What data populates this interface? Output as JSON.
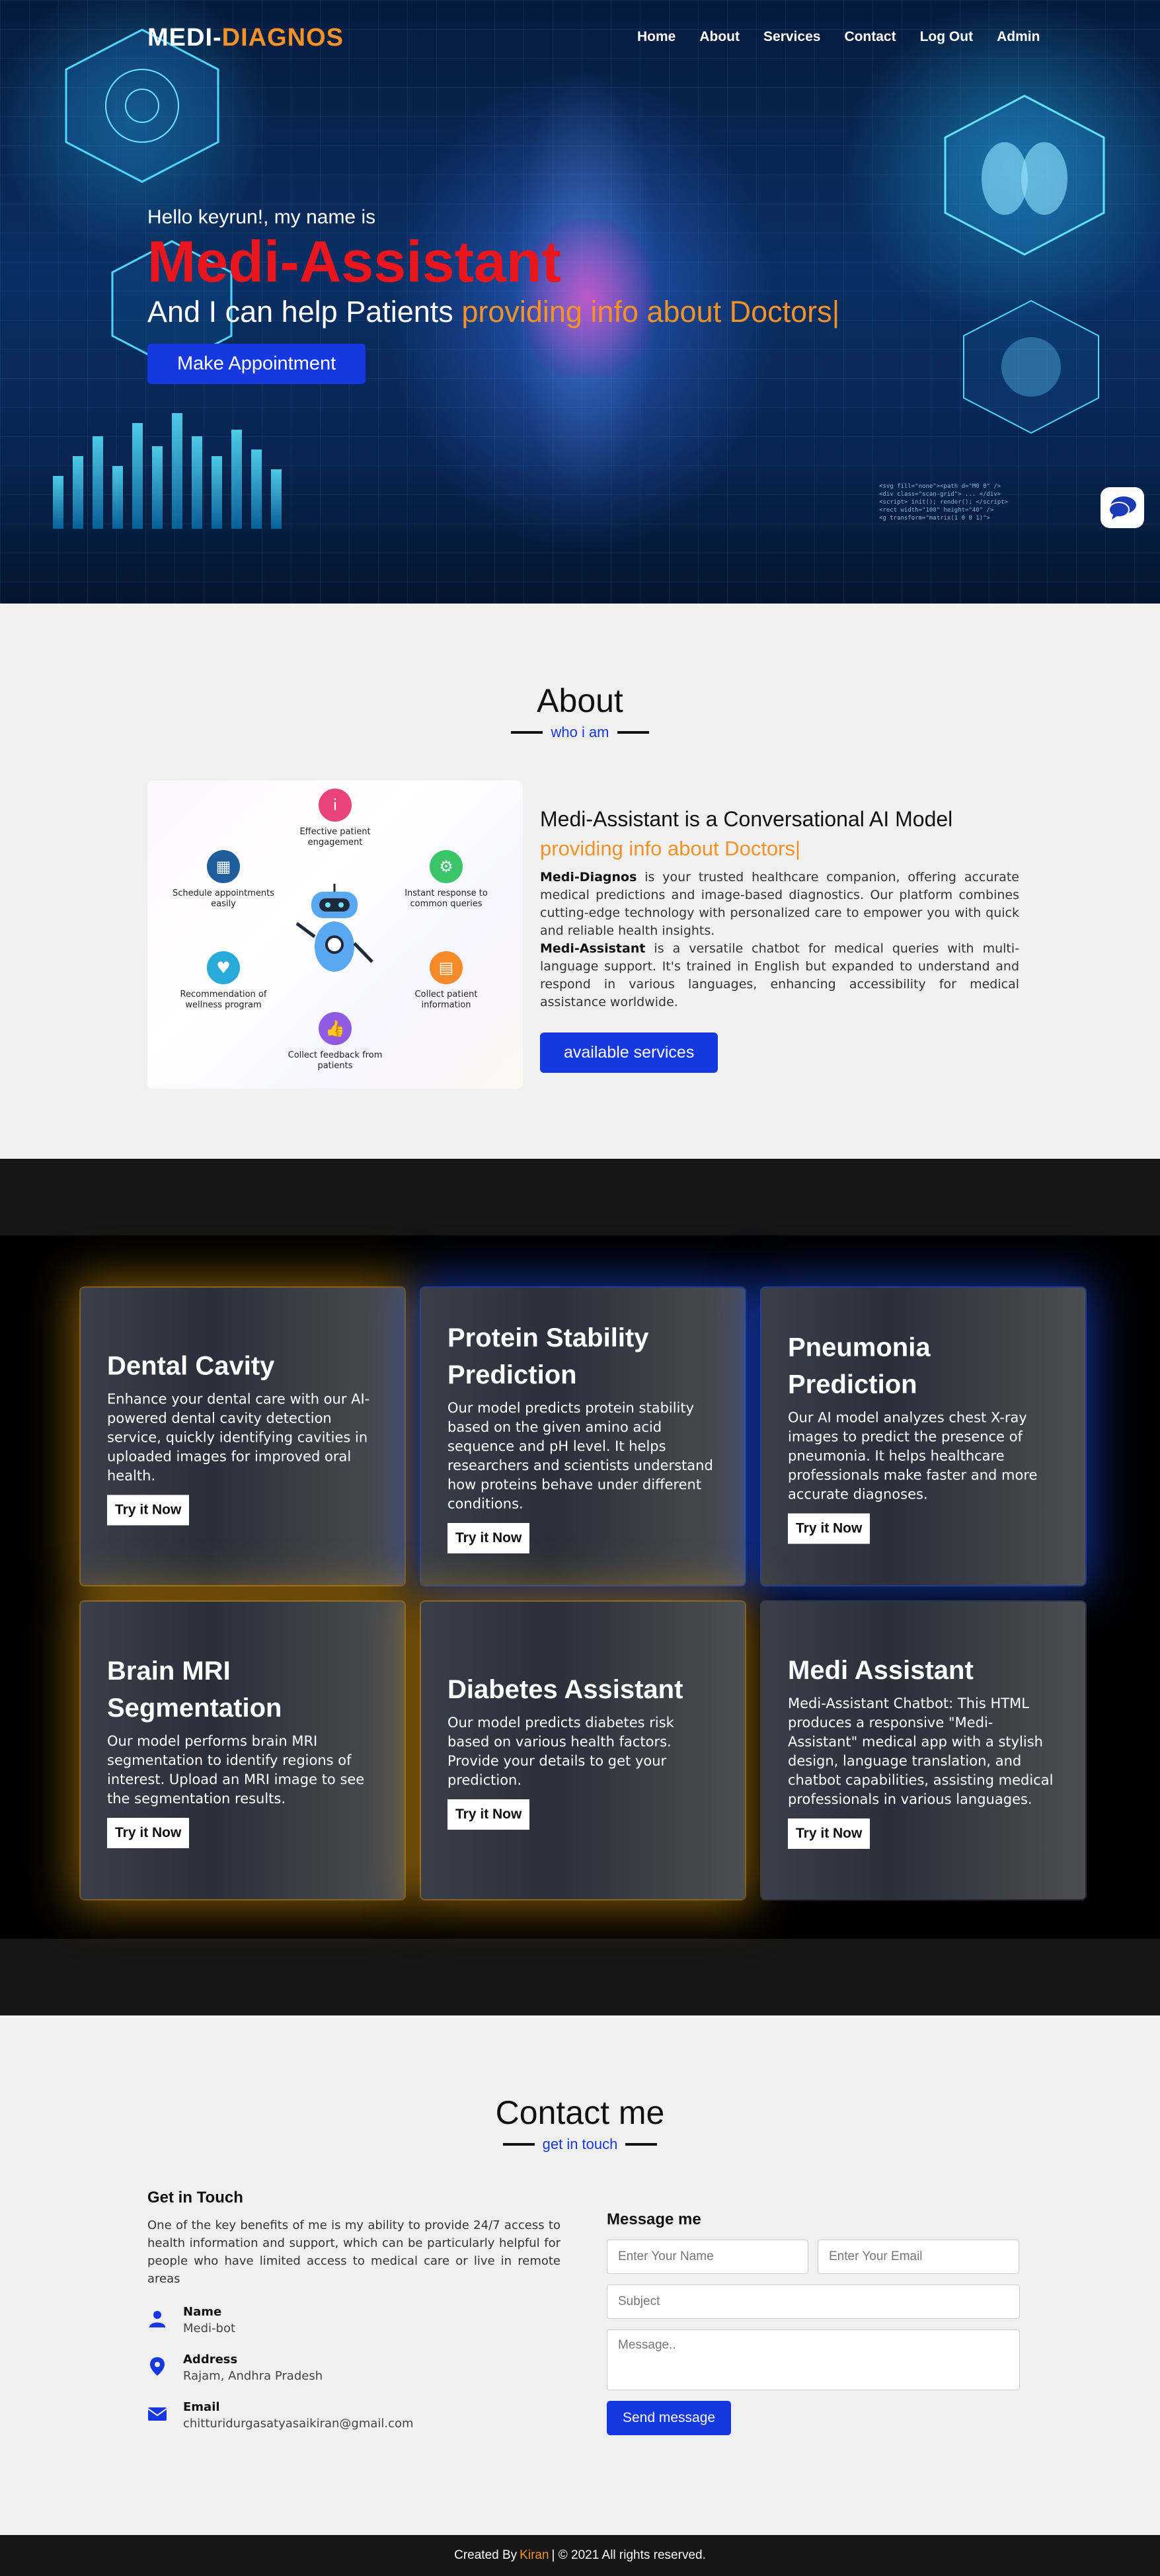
{
  "nav": {
    "logo_part1": "MEDI-",
    "logo_part2": "DIAGNOS",
    "links": [
      "Home",
      "About",
      "Services",
      "Contact",
      "Log Out",
      "Admin"
    ]
  },
  "hero": {
    "greeting": "Hello keyrun!, my name is",
    "title": "Medi-Assistant",
    "line_prefix": "And I can help Patients ",
    "typed_text": "providing info about Doctors|",
    "button": "Make Appointment",
    "chat_icon": "chat-bubble-icon"
  },
  "about": {
    "title": "About",
    "subtitle": "who i am",
    "heading": "Medi-Assistant is a Conversational AI Model",
    "typed_text": "providing info about Doctors|",
    "p1_bold": "Medi-Diagnos",
    "p1_text": " is your trusted healthcare companion, offering accurate medical predictions and image-based diagnostics. Our platform combines cutting-edge technology with personalized care to empower you with quick and reliable health insights.",
    "p2_bold": "Medi-Assistant",
    "p2_text": " is a versatile chatbot for medical queries with multi-language support. It's trained in English but expanded to understand and respond in various languages, enhancing accessibility for medical assistance worldwide.",
    "button": "available services",
    "features": [
      {
        "label": "Effective patient engagement",
        "icon": "info-person-icon",
        "color": "#e8437a"
      },
      {
        "label": "Instant response to common queries",
        "icon": "gear-person-icon",
        "color": "#3cc46b"
      },
      {
        "label": "Collect patient information",
        "icon": "document-icon",
        "color": "#f58a2b"
      },
      {
        "label": "Collect feedback from patients",
        "icon": "thumbs-up-icon",
        "color": "#8f5be0"
      },
      {
        "label": "Recommendation of wellness program",
        "icon": "heart-plus-icon",
        "color": "#2aaad8"
      },
      {
        "label": "Schedule appointments easily",
        "icon": "calendar-icon",
        "color": "#1e5e9a"
      }
    ]
  },
  "services": {
    "try_label": "Try it Now",
    "cards": [
      {
        "title": "Dental Cavity",
        "desc": "Enhance your dental care with our AI-powered dental cavity detection service, quickly identifying cavities in uploaded images for improved oral health."
      },
      {
        "title": "Protein Stability Prediction",
        "desc": "Our model predicts protein stability based on the given amino acid sequence and pH level. It helps researchers and scientists understand how proteins behave under different conditions."
      },
      {
        "title": "Pneumonia Prediction",
        "desc": "Our AI model analyzes chest X-ray images to predict the presence of pneumonia. It helps healthcare professionals make faster and more accurate diagnoses."
      },
      {
        "title": "Brain MRI Segmentation",
        "desc": "Our model performs brain MRI segmentation to identify regions of interest. Upload an MRI image to see the segmentation results."
      },
      {
        "title": "Diabetes Assistant",
        "desc": "Our model predicts diabetes risk based on various health factors. Provide your details to get your prediction."
      },
      {
        "title": "Medi Assistant",
        "desc": "Medi-Assistant Chatbot: This HTML produces a responsive \"Medi-Assistant\" medical app with a stylish design, language translation, and chatbot capabilities, assisting medical professionals in various languages."
      }
    ]
  },
  "contact": {
    "title": "Contact me",
    "subtitle": "get in touch",
    "get_in_touch": "Get in Touch",
    "description": "One of the key benefits of me is my ability to provide 24/7 access to health information and support, which can be particularly helpful for people who have limited access to medical care or live in remote areas",
    "info": [
      {
        "label": "Name",
        "value": "Medi-bot",
        "icon": "user-icon"
      },
      {
        "label": "Address",
        "value": "Rajam, Andhra Pradesh",
        "icon": "map-pin-icon"
      },
      {
        "label": "Email",
        "value": "chitturidurgasatyasaikiran@gmail.com",
        "icon": "envelope-icon"
      }
    ],
    "form": {
      "heading": "Message me",
      "name_placeholder": "Enter Your Name",
      "email_placeholder": "Enter Your Email",
      "subject_placeholder": "Subject",
      "message_placeholder": "Message..",
      "send": "Send message"
    }
  },
  "footer": {
    "prefix": "Created By",
    "name": "Kiran",
    "suffix": "| © 2021 All rights reserved."
  },
  "colors": {
    "accent": "#1638e0",
    "orange": "#f29227",
    "red": "#e9161d"
  }
}
